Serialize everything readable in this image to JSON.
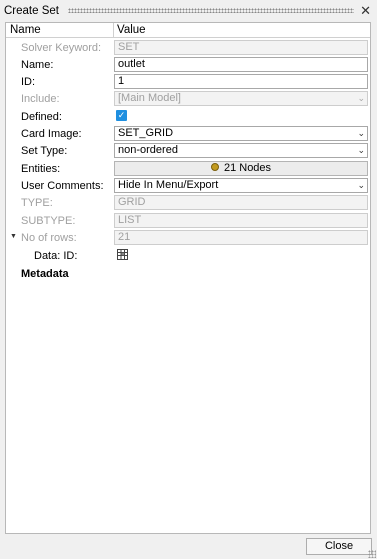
{
  "window": {
    "title": "Create Set"
  },
  "table": {
    "col_name": "Name",
    "col_value": "Value"
  },
  "rows": {
    "solver_keyword": {
      "label": "Solver Keyword:",
      "value": "SET"
    },
    "name": {
      "label": "Name:",
      "value": "outlet"
    },
    "id": {
      "label": "ID:",
      "value": "1"
    },
    "include": {
      "label": "Include:",
      "value": "[Main Model]"
    },
    "defined": {
      "label": "Defined:",
      "checked": true
    },
    "card_image": {
      "label": "Card Image:",
      "value": "SET_GRID"
    },
    "set_type": {
      "label": "Set Type:",
      "value": "non-ordered"
    },
    "entities": {
      "label": "Entities:",
      "value": "21 Nodes"
    },
    "user_comments": {
      "label": "User Comments:",
      "value": "Hide In Menu/Export"
    },
    "type": {
      "label": "TYPE:",
      "value": "GRID"
    },
    "subtype": {
      "label": "SUBTYPE:",
      "value": "LIST"
    },
    "no_of_rows": {
      "label": "No of rows:",
      "value": "21"
    },
    "data_id": {
      "label": "Data: ID:"
    }
  },
  "metadata_label": "Metadata",
  "footer": {
    "close_label": "Close"
  },
  "icons": {
    "close": "close-icon",
    "check": "check-icon",
    "node": "node-icon",
    "table": "table-icon"
  },
  "colors": {
    "accent": "#1e8fe0",
    "node_dot": "#c29a1f"
  }
}
